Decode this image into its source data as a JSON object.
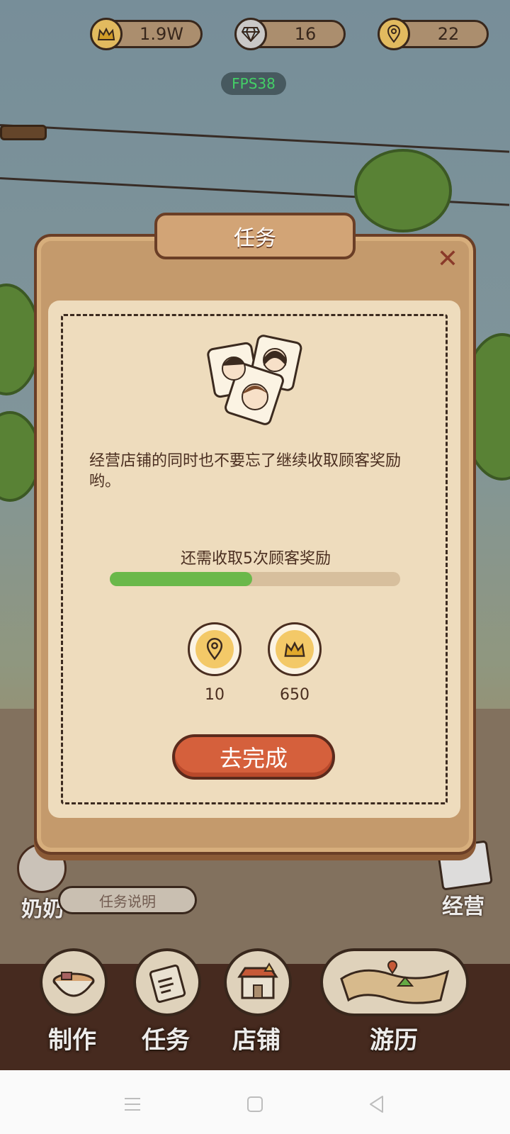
{
  "currency": {
    "coins": "1.9W",
    "diamonds": "16",
    "locations": "22"
  },
  "fps": "FPS38",
  "modal": {
    "title": "任务",
    "description": "经营店铺的同时也不要忘了继续收取顾客奖励哟。",
    "progress_label": "还需收取5次顾客奖励",
    "progress_fraction": 0.49,
    "rewards": [
      {
        "icon": "location-pin-icon",
        "value": "10"
      },
      {
        "icon": "crown-coin-icon",
        "value": "650"
      }
    ],
    "go_button": "去完成"
  },
  "side": {
    "grandma_name": "奶奶",
    "task_desc_button": "任务说明",
    "manage_label": "经营"
  },
  "nav": {
    "make": "制作",
    "tasks": "任务",
    "shop": "店铺",
    "travel": "游历"
  },
  "colors": {
    "progress": "#6ab84a",
    "button": "#d5603c",
    "wood": "#c49a6c"
  }
}
